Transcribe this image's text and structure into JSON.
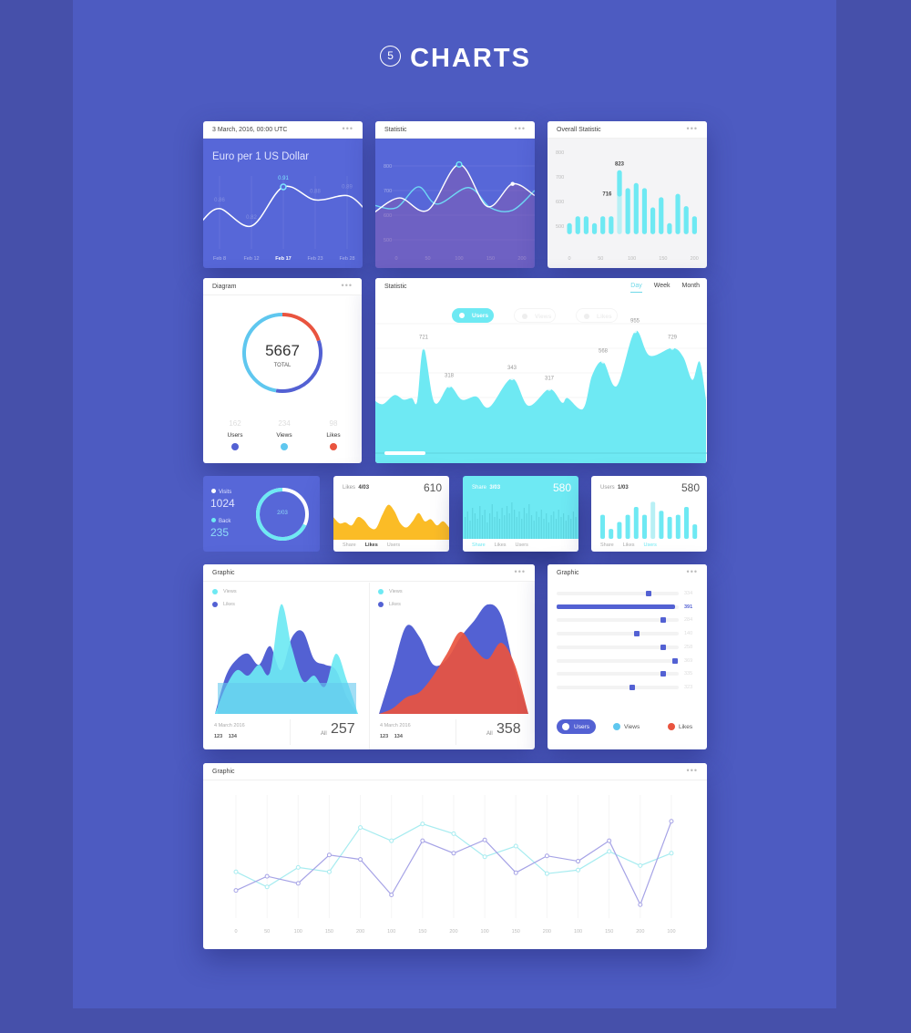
{
  "page": {
    "section_number": "5",
    "title": "CHARTS"
  },
  "colors": {
    "blue": "#5767d8",
    "cyan": "#6ee9f3",
    "light_blue": "#5fc7ef",
    "yellow": "#fbbc26",
    "red": "#e9543f",
    "dark_blue": "#5361d3"
  },
  "menu_icon": "more-dots-icon",
  "euro_card": {
    "header": "3 March, 2016, 00:00 UTC",
    "title": "Euro per 1 US Dollar"
  },
  "statistic_small": {
    "header": "Statistic"
  },
  "overall": {
    "header": "Overall Statistic"
  },
  "diagram": {
    "header": "Diagram",
    "total": "5667",
    "total_label": "TOTAL",
    "items": [
      {
        "value": "162",
        "label": "Users"
      },
      {
        "value": "234",
        "label": "Views"
      },
      {
        "value": "98",
        "label": "Likes"
      }
    ]
  },
  "statistic_big": {
    "header": "Statistic",
    "tabs": [
      "Day",
      "Week",
      "Month"
    ],
    "active_tab": "Day",
    "legend": [
      "Users",
      "Views",
      "Likes"
    ],
    "active_legend": "Users"
  },
  "visits": {
    "visits_label": "Visits",
    "visits_value": "1024",
    "back_label": "Back",
    "back_value": "235",
    "ring_label": "2/03",
    "ring_progress": 0.82
  },
  "likes_card": {
    "label": "Likes",
    "date": "4/03",
    "value": "610",
    "tabs": [
      "Share",
      "Likes",
      "Users"
    ],
    "active": 1
  },
  "share_card": {
    "label": "Share",
    "date": "3/03",
    "value": "580",
    "tabs": [
      "Share",
      "Likes",
      "Users"
    ],
    "active": 0
  },
  "users_card": {
    "label": "Users",
    "date": "1/03",
    "value": "580",
    "tabs": [
      "Share",
      "Likes",
      "Users"
    ],
    "active": 2
  },
  "graphic_mountains": {
    "header": "Graphic",
    "panels": [
      {
        "legend": [
          "Views",
          "Likes"
        ],
        "date": "4 March 2016",
        "n1": "123",
        "n2": "134",
        "all_label": "All",
        "total": "257"
      },
      {
        "legend": [
          "Views",
          "Likes"
        ],
        "date": "4 March 2016",
        "n1": "123",
        "n2": "134",
        "all_label": "All",
        "total": "358"
      }
    ]
  },
  "graphic_bars": {
    "header": "Graphic",
    "rows": [
      {
        "value": "334",
        "level": 0.75
      },
      {
        "value": "391",
        "level": 0.97,
        "highlight": true
      },
      {
        "value": "284",
        "level": 0.87
      },
      {
        "value": "140",
        "level": 0.66
      },
      {
        "value": "258",
        "level": 0.87
      },
      {
        "value": "369",
        "level": 0.97
      },
      {
        "value": "335",
        "level": 0.87
      },
      {
        "value": "323",
        "level": 0.62
      }
    ],
    "legend": [
      "Users",
      "Views",
      "Likes"
    ],
    "active_legend": "Users"
  },
  "graphic_lines": {
    "header": "Graphic"
  },
  "chart_data": [
    {
      "id": "euro",
      "type": "line",
      "categories": [
        "Feb 8",
        "Feb 12",
        "Feb 17",
        "Feb 23",
        "Feb 28"
      ],
      "values": [
        0.86,
        0.82,
        0.91,
        0.88,
        0.89
      ],
      "highlight": "Feb 17"
    },
    {
      "id": "stat_small",
      "type": "line",
      "xticks": [
        "0",
        "50",
        "100",
        "150",
        "200"
      ],
      "yticks": [
        "800",
        "700",
        "600",
        "500"
      ],
      "xlim": [
        0,
        200
      ],
      "ylim": [
        500,
        800
      ],
      "series": [
        {
          "points": [
            [
              -35,
              611
            ],
            [
              5,
              670
            ],
            [
              50,
              620
            ],
            [
              100,
              806
            ],
            [
              145,
              635
            ],
            [
              185,
              727
            ],
            [
              220,
              680
            ]
          ]
        },
        {
          "points": [
            [
              -35,
              640
            ],
            [
              0,
              630
            ],
            [
              35,
              715
            ],
            [
              65,
              645
            ],
            [
              115,
              712
            ],
            [
              150,
              630
            ],
            [
              185,
              620
            ],
            [
              220,
              700
            ]
          ]
        }
      ]
    },
    {
      "id": "overall",
      "type": "bar",
      "xticks": [
        "0",
        "50",
        "100",
        "150",
        "200"
      ],
      "yticks": [
        "800",
        "700",
        "600",
        "500"
      ],
      "ylim": [
        467,
        800
      ],
      "values": [
        512,
        540,
        540,
        512,
        540,
        540,
        727,
        654,
        675,
        654,
        576,
        617,
        512,
        631,
        581,
        540
      ],
      "highlight_index": 6,
      "highlight_inner": 631,
      "annotations": [
        "823",
        "716"
      ]
    },
    {
      "id": "diagram",
      "type": "pie",
      "slices": [
        {
          "label": "Likes",
          "value": 98
        },
        {
          "label": "Users",
          "value": 162
        },
        {
          "label": "Views",
          "value": 234
        }
      ]
    },
    {
      "id": "big_area",
      "type": "area",
      "points": [
        [
          0,
          175
        ],
        [
          1,
          160
        ],
        [
          2.3,
          190
        ],
        [
          3.3,
          175
        ],
        [
          4.2,
          180
        ],
        [
          4.8,
          170
        ],
        [
          5.5,
          345
        ],
        [
          6.7,
          165
        ],
        [
          8.3,
          220
        ],
        [
          9.7,
          175
        ],
        [
          11.3,
          185
        ],
        [
          12.7,
          150
        ],
        [
          15.2,
          245
        ],
        [
          17,
          155
        ],
        [
          19.3,
          210
        ],
        [
          20.7,
          165
        ],
        [
          21.3,
          180
        ],
        [
          23,
          145
        ],
        [
          24,
          255
        ],
        [
          25.2,
          300
        ],
        [
          26.7,
          220
        ],
        [
          28.7,
          400
        ],
        [
          30.3,
          320
        ],
        [
          32.8,
          345
        ],
        [
          34,
          315
        ],
        [
          35,
          240
        ],
        [
          35.8,
          300
        ],
        [
          36.5,
          175
        ]
      ],
      "labels": [
        {
          "index": 6,
          "text": "721"
        },
        {
          "index": 8,
          "text": "318"
        },
        {
          "index": 12,
          "text": "343"
        },
        {
          "index": 14,
          "text": "317"
        },
        {
          "index": 19,
          "text": "568"
        },
        {
          "index": 21,
          "text": "955"
        },
        {
          "index": 23,
          "text": "729"
        }
      ]
    },
    {
      "id": "likes_area",
      "type": "area",
      "values": [
        55,
        40,
        42,
        35,
        55,
        48,
        30,
        28,
        60,
        85,
        70,
        40,
        30,
        45,
        65,
        45,
        50,
        35,
        45,
        30
      ]
    },
    {
      "id": "share_bars",
      "type": "bar",
      "values": [
        60,
        75,
        50,
        85,
        70,
        55,
        90,
        65,
        80,
        45,
        70,
        95,
        60,
        75,
        55,
        85,
        65,
        90,
        70,
        100,
        80,
        60,
        75,
        55,
        85,
        70,
        95,
        65,
        50,
        75,
        60,
        80,
        55,
        70,
        45,
        65,
        75,
        55,
        80,
        60,
        70,
        50,
        65,
        55,
        75,
        60
      ]
    },
    {
      "id": "users_bars",
      "type": "bar",
      "values": [
        80,
        33,
        56,
        80,
        106,
        80,
        123,
        93,
        73,
        80,
        106,
        48
      ],
      "highlight_index": 6
    },
    {
      "id": "mountain_left",
      "type": "area",
      "series": [
        {
          "name": "Likes",
          "values": [
            0,
            35,
            50,
            55,
            45,
            62,
            40,
            70,
            75,
            50,
            45,
            40,
            15,
            0
          ]
        },
        {
          "name": "Views",
          "values": [
            0,
            25,
            40,
            35,
            45,
            38,
            100,
            60,
            30,
            35,
            25,
            55,
            30,
            0
          ]
        }
      ]
    },
    {
      "id": "mountain_right",
      "type": "area",
      "series": [
        {
          "name": "Likes",
          "values": [
            0,
            40,
            80,
            70,
            45,
            50,
            70,
            85,
            100,
            90,
            40,
            0
          ]
        },
        {
          "name": "Views",
          "values": [
            0,
            5,
            15,
            20,
            35,
            55,
            75,
            60,
            50,
            65,
            45,
            0
          ]
        }
      ]
    },
    {
      "id": "lines",
      "type": "line",
      "xticks": [
        "0",
        "50",
        "100",
        "150",
        "200",
        "100",
        "150",
        "200",
        "100",
        "150",
        "200",
        "100",
        "150",
        "200",
        "100"
      ],
      "ylim": [
        0,
        110
      ],
      "series": [
        {
          "values": [
            45,
            28,
            50,
            45,
            95,
            80,
            99,
            88,
            62,
            74,
            43,
            47,
            68,
            52,
            66
          ]
        },
        {
          "values": [
            24,
            40,
            32,
            64,
            59,
            19,
            80,
            66,
            81,
            44,
            63,
            57,
            80,
            8,
            102
          ]
        }
      ]
    }
  ]
}
